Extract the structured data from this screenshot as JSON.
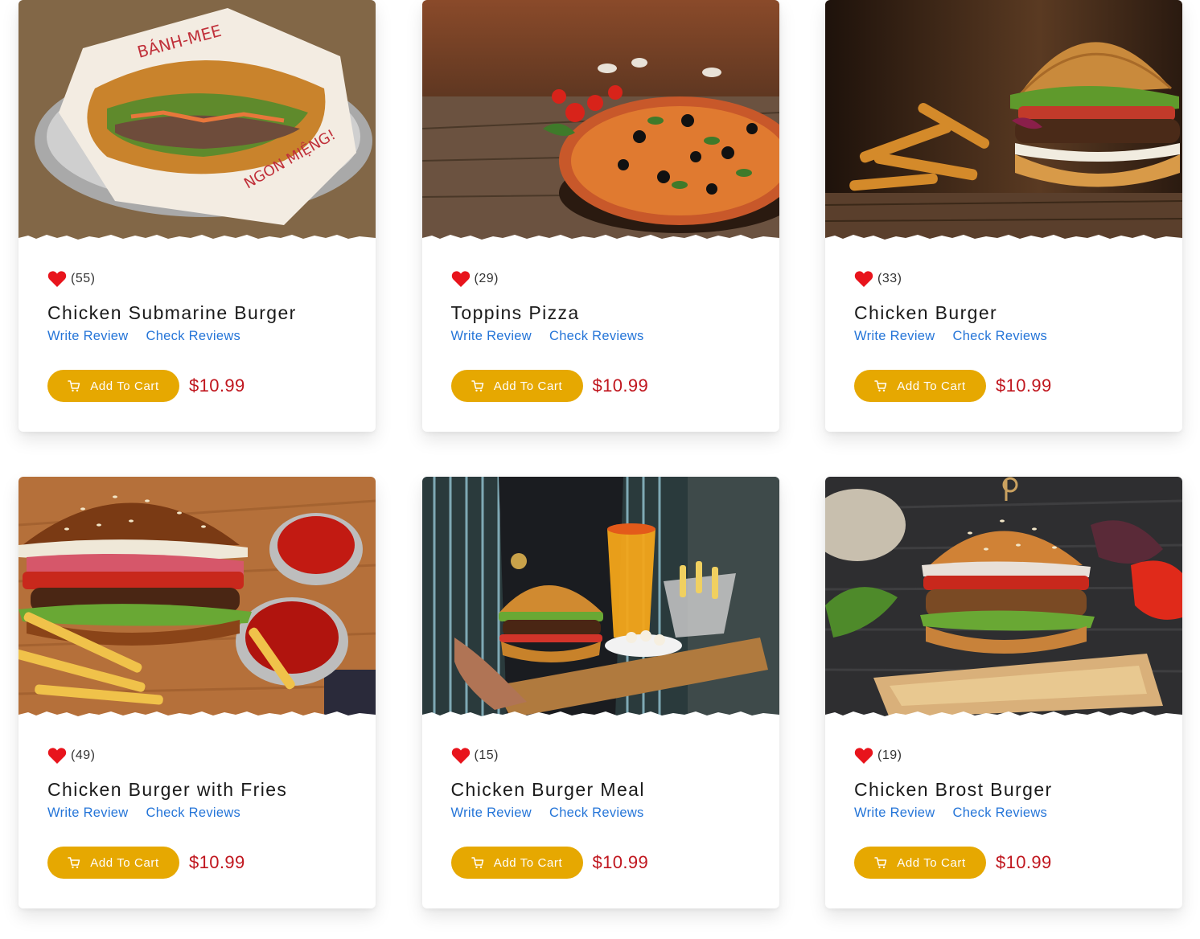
{
  "products": [
    {
      "rating_count": "(55)",
      "name": "Chicken Submarine Burger",
      "write_review": "Write Review",
      "check_reviews": "Check Reviews",
      "cart_label": "Add To Cart",
      "price": "$10.99"
    },
    {
      "rating_count": "(29)",
      "name": "Toppins Pizza",
      "write_review": "Write Review",
      "check_reviews": "Check Reviews",
      "cart_label": "Add To Cart",
      "price": "$10.99"
    },
    {
      "rating_count": "(33)",
      "name": "Chicken Burger",
      "write_review": "Write Review",
      "check_reviews": "Check Reviews",
      "cart_label": "Add To Cart",
      "price": "$10.99"
    },
    {
      "rating_count": "(49)",
      "name": "Chicken Burger with Fries",
      "write_review": "Write Review",
      "check_reviews": "Check Reviews",
      "cart_label": "Add To Cart",
      "price": "$10.99"
    },
    {
      "rating_count": "(15)",
      "name": "Chicken Burger Meal",
      "write_review": "Write Review",
      "check_reviews": "Check Reviews",
      "cart_label": "Add To Cart",
      "price": "$10.99"
    },
    {
      "rating_count": "(19)",
      "name": "Chicken Brost Burger",
      "write_review": "Write Review",
      "check_reviews": "Check Reviews",
      "cart_label": "Add To Cart",
      "price": "$10.99"
    }
  ],
  "icons": {
    "rating": "heart-icon",
    "cart": "shopping-cart-icon"
  },
  "colors": {
    "accent": "#e6a801",
    "price": "#c0161e",
    "link": "#2575d8",
    "heart": "#e8141c"
  }
}
